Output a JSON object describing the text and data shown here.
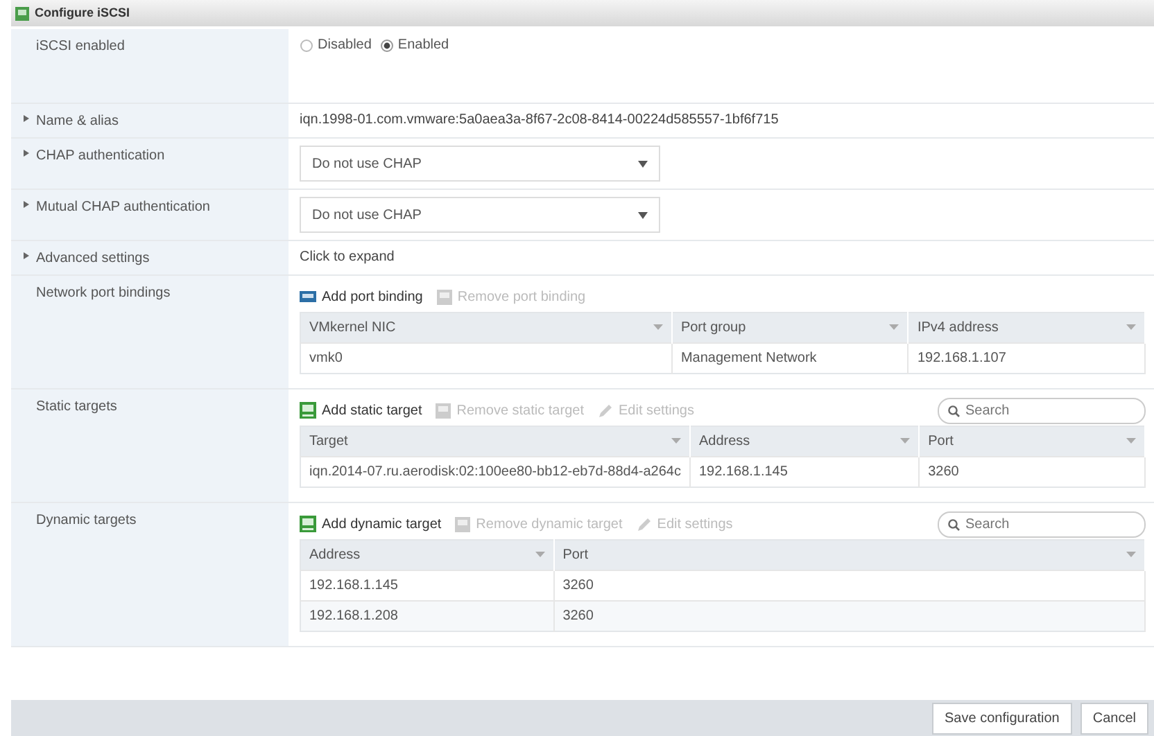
{
  "window": {
    "title": "Configure iSCSI"
  },
  "rows": [
    {
      "kind": "radio",
      "label": "iSCSI enabled",
      "expandable": false,
      "options": [
        {
          "label": "Disabled",
          "selected": false
        },
        {
          "label": "Enabled",
          "selected": true
        }
      ]
    },
    {
      "kind": "text",
      "label": "Name & alias",
      "expandable": true,
      "value": "iqn.1998-01.com.vmware:5a0aea3a-8f67-2c08-8414-00224d585557-1bf6f715"
    },
    {
      "kind": "select",
      "label": "CHAP authentication",
      "expandable": true,
      "value": "Do not use CHAP"
    },
    {
      "kind": "select",
      "label": "Mutual CHAP authentication",
      "expandable": true,
      "value": "Do not use CHAP"
    },
    {
      "kind": "text",
      "label": "Advanced settings",
      "expandable": true,
      "value": "Click to expand"
    },
    {
      "kind": "table",
      "label": "Network port bindings",
      "expandable": false,
      "toolbar": [
        {
          "label": "Add port binding",
          "disabled": false
        },
        {
          "label": "Remove port binding",
          "disabled": true
        }
      ],
      "columns": [
        "VMkernel NIC",
        "Port group",
        "IPv4 address"
      ],
      "table_rows": [
        [
          "vmk0",
          "Management Network",
          "192.168.1.107"
        ]
      ]
    },
    {
      "kind": "table",
      "label": "Static targets",
      "expandable": false,
      "search": {
        "placeholder": "Search"
      },
      "toolbar": [
        {
          "label": "Add static target",
          "disabled": false
        },
        {
          "label": "Remove static target",
          "disabled": true
        },
        {
          "label": "Edit settings",
          "disabled": true
        }
      ],
      "columns": [
        "Target",
        "Address",
        "Port"
      ],
      "table_rows": [
        [
          "iqn.2014-07.ru.aerodisk:02:100ee80-bb12-eb7d-88d4-a264c",
          "192.168.1.145",
          "3260"
        ]
      ]
    },
    {
      "kind": "table",
      "label": "Dynamic targets",
      "expandable": false,
      "search": {
        "placeholder": "Search"
      },
      "toolbar": [
        {
          "label": "Add dynamic target",
          "disabled": false
        },
        {
          "label": "Remove dynamic target",
          "disabled": true
        },
        {
          "label": "Edit settings",
          "disabled": true
        }
      ],
      "columns": [
        "Address",
        "Port"
      ],
      "table_rows": [
        [
          "192.168.1.145",
          "3260"
        ],
        [
          "192.168.1.208",
          "3260"
        ]
      ]
    }
  ],
  "buttons": [
    "Save configuration",
    "Cancel"
  ]
}
